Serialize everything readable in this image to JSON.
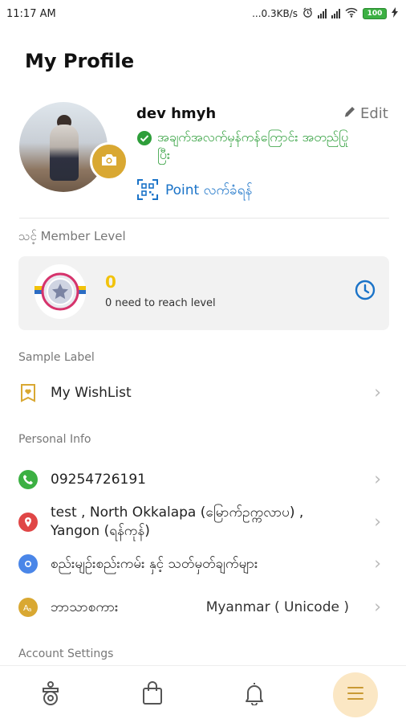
{
  "status_bar": {
    "time": "11:17 AM",
    "net_speed": "...0.3KB/s",
    "battery": "100"
  },
  "page": {
    "title": "My Profile"
  },
  "profile": {
    "name": "dev hmyh",
    "edit_label": "Edit",
    "verified_text": "အချက်အလက်မှန်ကန်ကြောင်း အတည်ပြုပြီး",
    "point_label": "Point လက်ခံရန်"
  },
  "member_level": {
    "section_label": "သင့် Member Level",
    "level_value": "0",
    "level_desc": "0 need to reach  level"
  },
  "sections": {
    "sample_label": "Sample Label",
    "personal_info": "Personal Info",
    "account_settings": "Account Settings"
  },
  "rows": {
    "wishlist": "My WishList",
    "phone": "09254726191",
    "address": "test , North Okkalapa (မြောက်ဥက္ကလာပ) , Yangon (ရန်ကုန်)",
    "privacy": "စည်းမျဉ်းစည်းကမ်း နှင့် သတ်မှတ်ချက်များ",
    "language_label": "ဘာသာစကား",
    "language_value": "Myanmar ( Unicode )"
  },
  "colors": {
    "accent_gold": "#d9a832",
    "verified_green": "#2e9e3a",
    "link_blue": "#1a73c8",
    "level_yellow": "#f2c30c"
  }
}
